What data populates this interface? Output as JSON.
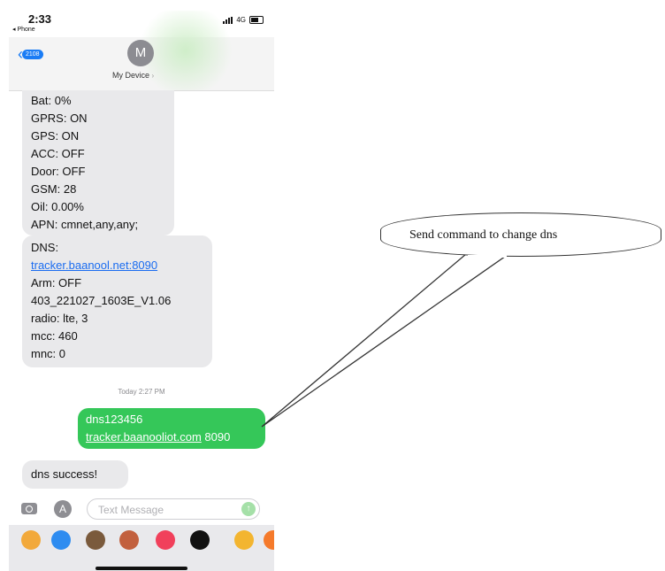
{
  "status_bar": {
    "time": "2:33",
    "back_app": "◂ Phone",
    "network": "4G"
  },
  "header": {
    "back_badge": "2108",
    "avatar_initial": "M",
    "contact_name": "My Device"
  },
  "messages": {
    "received_1": [
      "Bat: 0%",
      "GPRS: ON",
      "GPS: ON",
      "ACC: OFF",
      "Door: OFF",
      "GSM: 28",
      "Oil: 0.00%",
      "APN: cmnet,any,any;"
    ],
    "received_2": {
      "dns_label": "DNS:",
      "dns_link": "tracker.baanool.net:8090",
      "lines": [
        "Arm: OFF",
        "403_221027_1603E_V1.06",
        "radio: lte, 3",
        "mcc: 460",
        "mnc: 0"
      ]
    },
    "timestamp": "Today 2:27 PM",
    "sent": {
      "line1": "dns123456",
      "link": "tracker.baanooliot.com",
      "port": " 8090"
    },
    "received_3": "dns success!"
  },
  "composer": {
    "placeholder": "Text Message"
  },
  "app_drawer": {
    "icons": [
      {
        "name": "photos-app-icon",
        "color": "#f2a93b"
      },
      {
        "name": "app-store-app-icon",
        "color": "#2e8cf0"
      },
      {
        "name": "memoji-app-icon",
        "color": "#7a5a3c"
      },
      {
        "name": "memoji-2-app-icon",
        "color": "#c2603e"
      },
      {
        "name": "music-app-icon",
        "color": "#f1405b"
      },
      {
        "name": "heart-app-icon",
        "color": "#111111"
      },
      {
        "name": "yellow-app-icon",
        "color": "#f3b530"
      },
      {
        "name": "orange-app-icon",
        "color": "#f57a2b"
      }
    ]
  },
  "annotation": {
    "text": "Send command to change dns"
  }
}
